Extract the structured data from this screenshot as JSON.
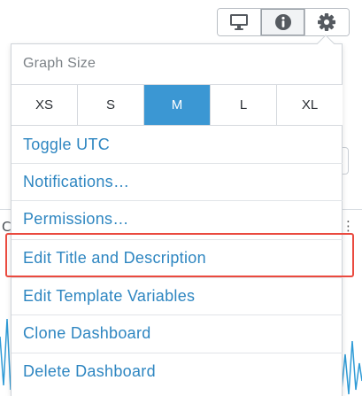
{
  "toolbar": {
    "buttons": [
      {
        "icon": "monitor-icon"
      },
      {
        "icon": "info-icon"
      },
      {
        "icon": "gear-icon"
      }
    ]
  },
  "menu": {
    "header": "Graph Size",
    "sizes": [
      "XS",
      "S",
      "M",
      "L",
      "XL"
    ],
    "selected_size": "M",
    "items": [
      "Toggle UTC",
      "Notifications…",
      "Permissions…",
      "Edit Title and Description",
      "Edit Template Variables",
      "Clone Dashboard",
      "Delete Dashboard"
    ],
    "highlighted_item": "Edit Title and Description"
  },
  "background": {
    "left_letter": "C"
  },
  "colors": {
    "accent": "#3b97d3",
    "link": "#2e86c1",
    "highlight": "#ea4a3f",
    "graph_line": "#2f9bd6"
  }
}
